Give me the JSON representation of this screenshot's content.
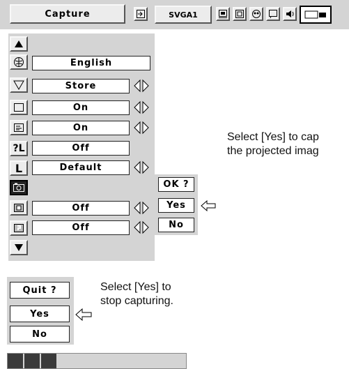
{
  "toolbar": {
    "title": "Capture",
    "source_label": "SVGA1",
    "icons": [
      "input-icon",
      "image-adjust-icon",
      "screen-icon",
      "color-icon",
      "setting-icon",
      "sound-icon",
      "capture-icon"
    ]
  },
  "menu": {
    "items": [
      {
        "icon": "up-arrow-icon",
        "value": null
      },
      {
        "icon": "language-icon",
        "value": "English"
      },
      {
        "icon": "store-icon",
        "value": "Store"
      },
      {
        "icon": "display-icon",
        "value": "On"
      },
      {
        "icon": "menu-display-icon",
        "value": "On"
      },
      {
        "icon": "key-lock-icon",
        "value": "Off"
      },
      {
        "icon": "logo-icon",
        "value": "Default"
      },
      {
        "icon": "capture-item-icon",
        "value": null
      },
      {
        "icon": "power-management-icon",
        "value": "Off"
      },
      {
        "icon": "security-icon",
        "value": "Off"
      },
      {
        "icon": "down-arrow-icon",
        "value": null
      }
    ]
  },
  "confirm_dialog": {
    "question": "OK ?",
    "yes": "Yes",
    "no": "No"
  },
  "note1": {
    "line1": "Select [Yes] to cap",
    "line2": "the projected imag"
  },
  "quit_dialog": {
    "question": "Quit ?",
    "yes": "Yes",
    "no": "No"
  },
  "note2": {
    "line1": "Select [Yes] to",
    "line2": "stop capturing."
  },
  "progress": {
    "filled_segments": 3,
    "fill_fraction": 0.28
  }
}
